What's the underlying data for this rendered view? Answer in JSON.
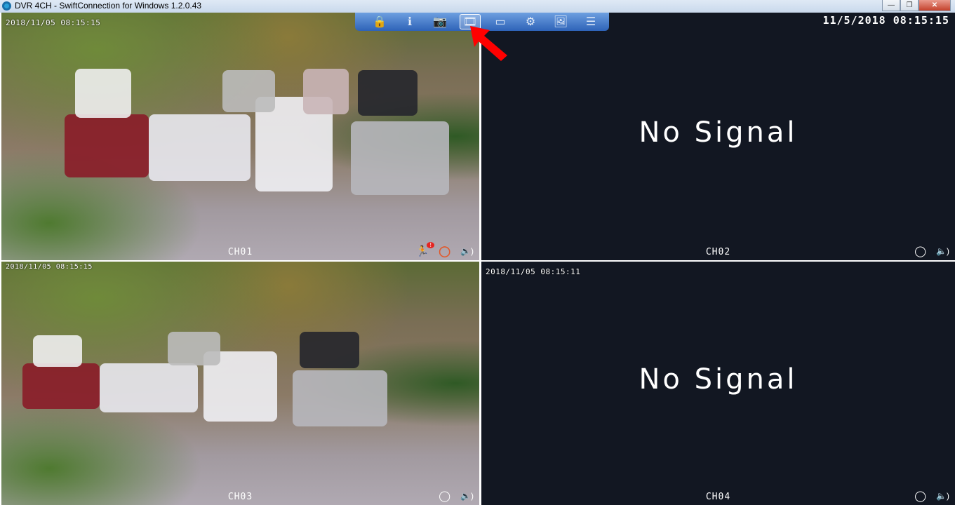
{
  "window": {
    "title": "DVR 4CH - SwiftConnection for Windows 1.2.0.43",
    "minimize": "—",
    "maximize": "❐",
    "close": "✕"
  },
  "toolbar": {
    "items": [
      {
        "name": "lock",
        "glyph": "🔒"
      },
      {
        "name": "info",
        "glyph": "ℹ"
      },
      {
        "name": "snapshot",
        "glyph": "📷"
      },
      {
        "name": "record",
        "glyph": "🎞"
      },
      {
        "name": "display",
        "glyph": "▭"
      },
      {
        "name": "settings",
        "glyph": "⚙"
      },
      {
        "name": "image",
        "glyph": "🖼"
      },
      {
        "name": "log",
        "glyph": "☰"
      }
    ]
  },
  "top_clock": "11/5/2018 08:15:15",
  "channels": [
    {
      "label": "CH01",
      "timestamp": "2018/11/05 08:15:15",
      "signal": true
    },
    {
      "label": "CH02",
      "signal": false,
      "message": "No Signal"
    },
    {
      "label": "CH03",
      "timestamp": "2018/11/05 08:15:15",
      "signal": true
    },
    {
      "label": "CH04",
      "timestamp": "2018/11/05 08:15:11",
      "signal": false,
      "message": "No Signal"
    }
  ],
  "icons": {
    "motion": "🏃",
    "motion_badge": "!",
    "chat": "◯",
    "audio": "🔈)"
  },
  "colors": {
    "accent_red": "#e52420",
    "toolbar_blue": "#2e63b8",
    "motion_orange": "#e2582a"
  }
}
